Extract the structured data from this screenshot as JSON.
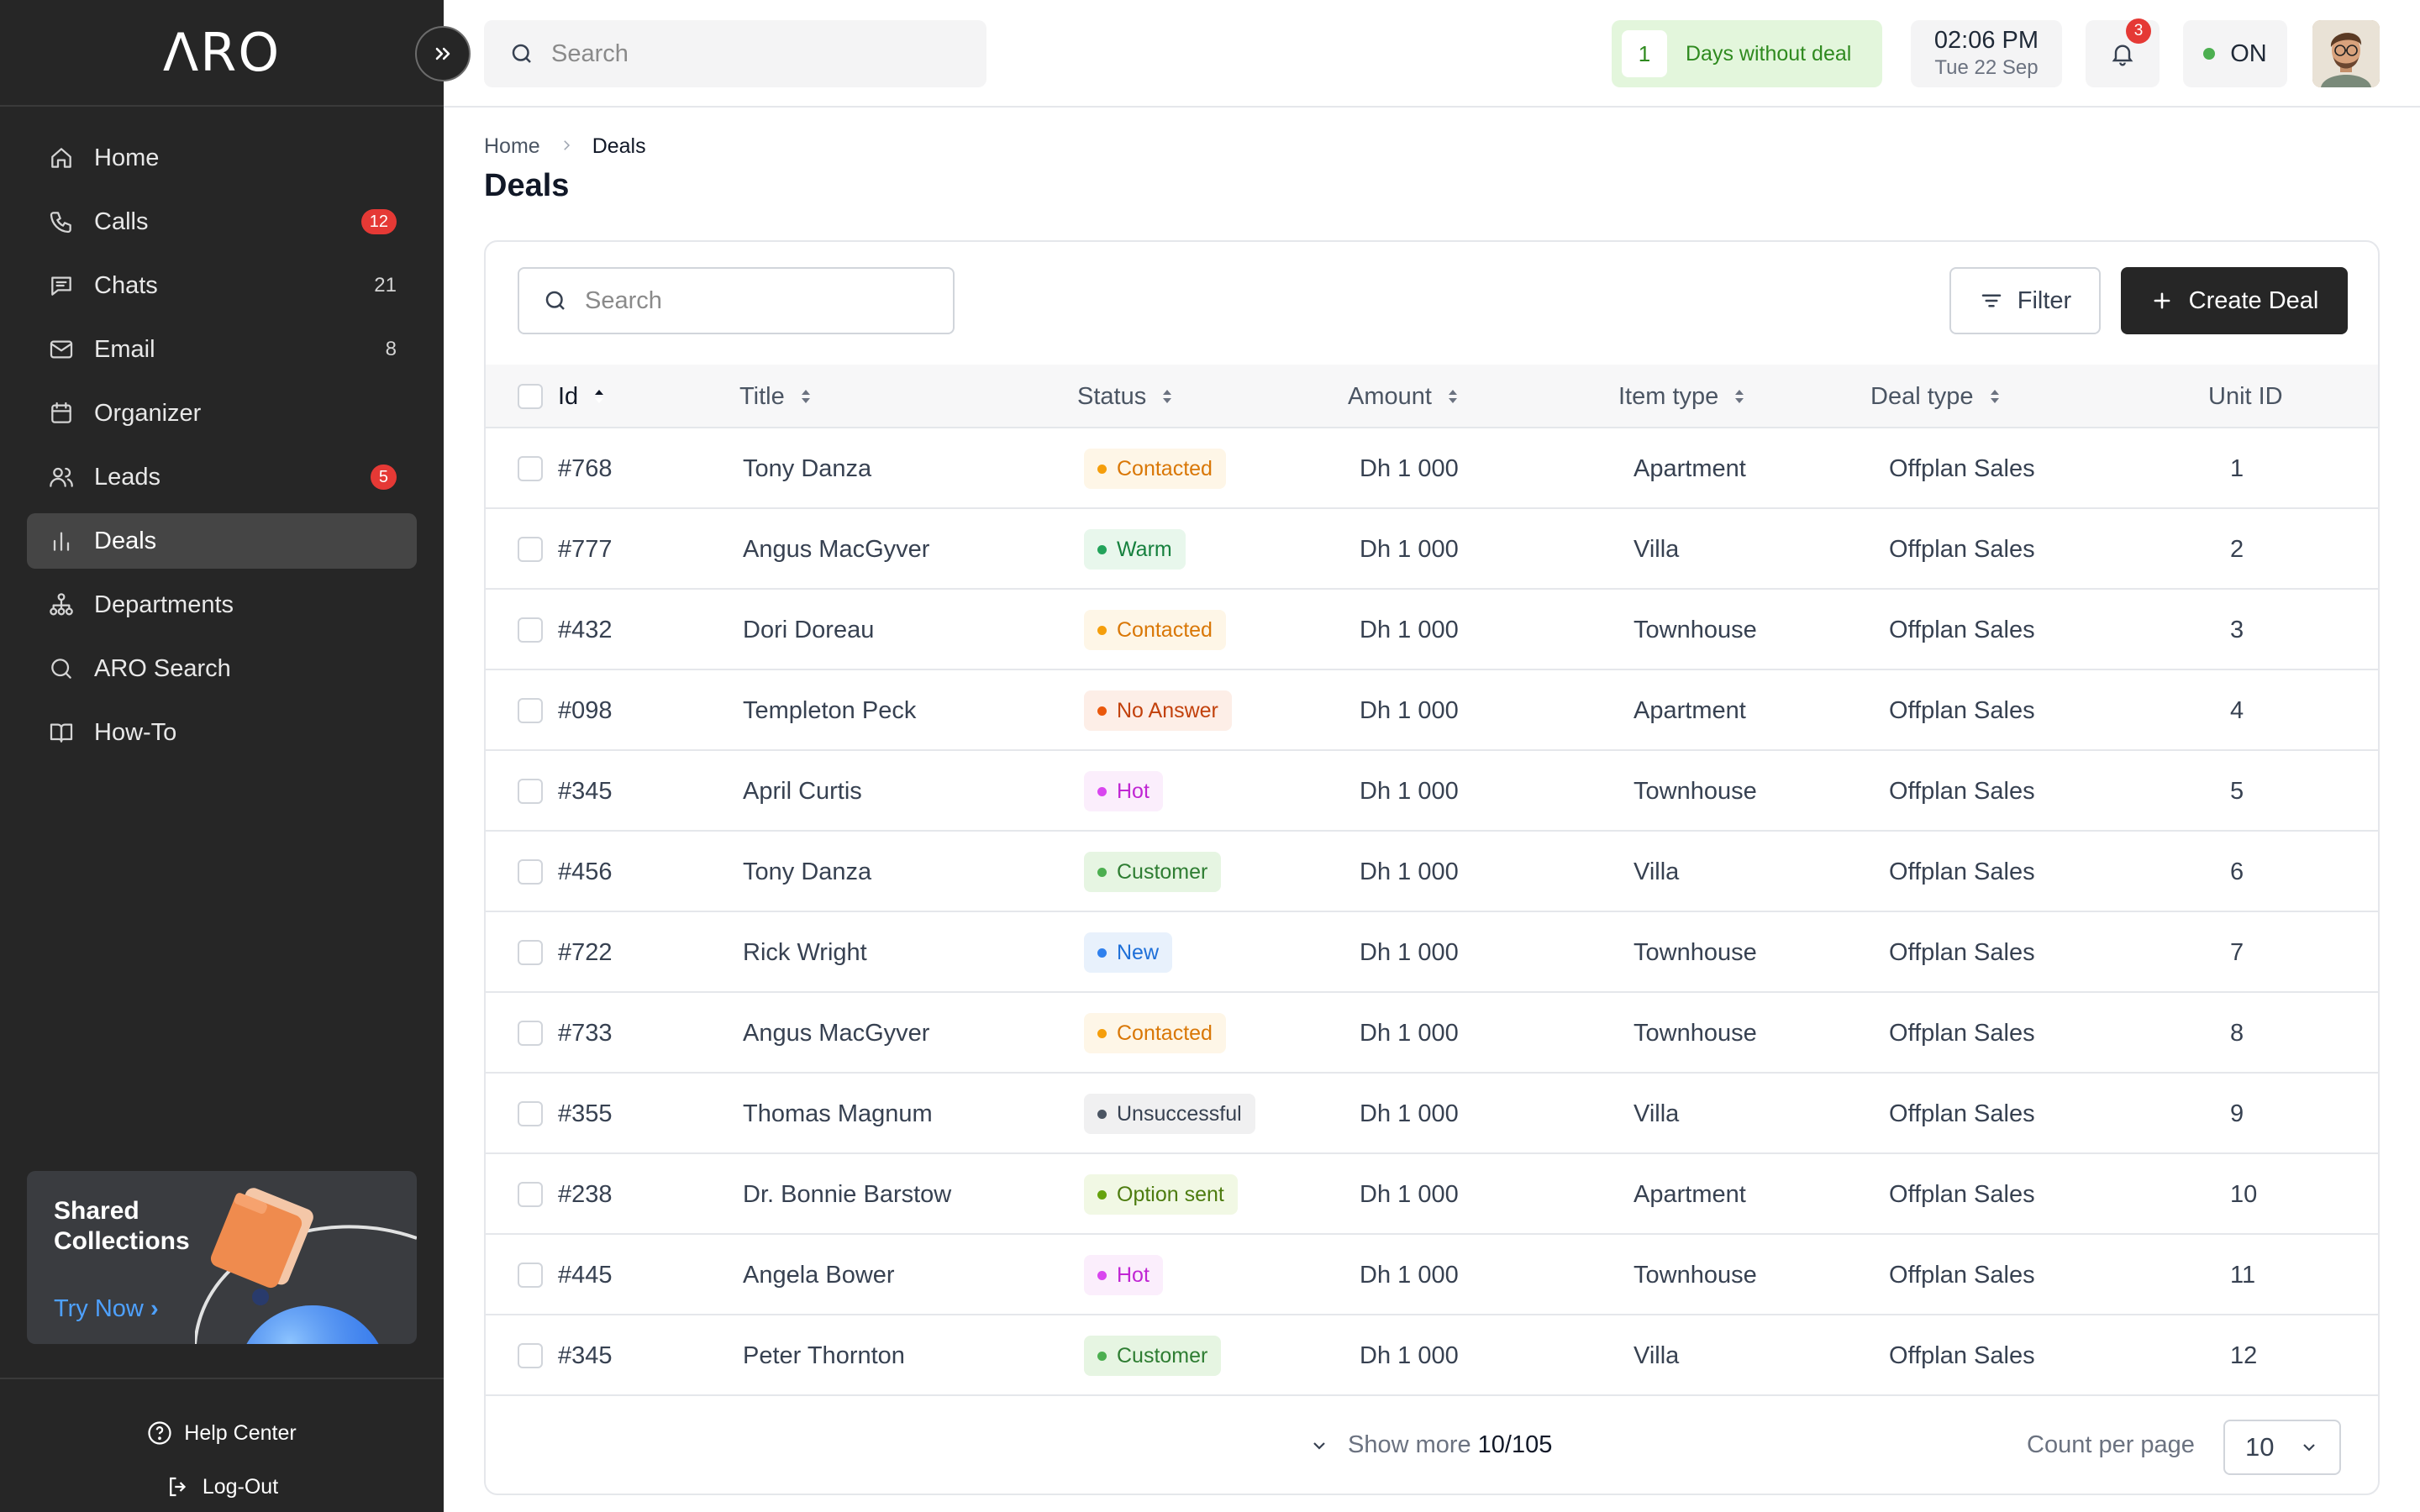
{
  "brand": {
    "logo": "ΛRO"
  },
  "sidebar": {
    "items": [
      {
        "label": "Home",
        "icon": "home-icon",
        "badge": ""
      },
      {
        "label": "Calls",
        "icon": "phone-icon",
        "badge": "12",
        "badge_style": "red"
      },
      {
        "label": "Chats",
        "icon": "chat-icon",
        "badge": "21"
      },
      {
        "label": "Email",
        "icon": "mail-icon",
        "badge": "8"
      },
      {
        "label": "Organizer",
        "icon": "calendar-icon",
        "badge": ""
      },
      {
        "label": "Leads",
        "icon": "users-icon",
        "badge": "5",
        "badge_style": "red"
      },
      {
        "label": "Deals",
        "icon": "bar-chart-icon",
        "badge": "",
        "active": true
      },
      {
        "label": "Departments",
        "icon": "org-chart-icon",
        "badge": ""
      },
      {
        "label": "ARO Search",
        "icon": "search-icon",
        "badge": ""
      },
      {
        "label": "How-To",
        "icon": "book-icon",
        "badge": ""
      }
    ],
    "promo": {
      "title": "Shared Collections",
      "cta": "Try Now"
    },
    "footer": {
      "help": "Help Center",
      "logout": "Log-Out"
    }
  },
  "topbar": {
    "search_placeholder": "Search",
    "deal_counter": {
      "count": "1",
      "label": "Days without deal"
    },
    "clock": {
      "time": "02:06 PM",
      "date": "Tue 22 Sep"
    },
    "notifications": "3",
    "status": "ON"
  },
  "breadcrumb": {
    "root": "Home",
    "current": "Deals"
  },
  "page": {
    "title": "Deals"
  },
  "toolbar": {
    "search_placeholder": "Search",
    "filter_label": "Filter",
    "create_label": "Create Deal"
  },
  "table": {
    "columns": [
      "Id",
      "Title",
      "Status",
      "Amount",
      "Item type",
      "Deal type",
      "Unit ID"
    ],
    "rows": [
      {
        "id": "#768",
        "title": "Tony Danza",
        "status": "Contacted",
        "amount": "Dh 1 000",
        "item": "Apartment",
        "deal": "Offplan Sales",
        "unit": "1"
      },
      {
        "id": "#777",
        "title": "Angus MacGyver",
        "status": "Warm",
        "amount": "Dh 1 000",
        "item": "Villa",
        "deal": "Offplan Sales",
        "unit": "2"
      },
      {
        "id": "#432",
        "title": "Dori Doreau",
        "status": "Contacted",
        "amount": "Dh 1 000",
        "item": "Townhouse",
        "deal": "Offplan Sales",
        "unit": "3"
      },
      {
        "id": "#098",
        "title": "Templeton Peck",
        "status": "No Answer",
        "amount": "Dh 1 000",
        "item": "Apartment",
        "deal": "Offplan Sales",
        "unit": "4"
      },
      {
        "id": "#345",
        "title": "April Curtis",
        "status": "Hot",
        "amount": "Dh 1 000",
        "item": "Townhouse",
        "deal": "Offplan Sales",
        "unit": "5"
      },
      {
        "id": "#456",
        "title": "Tony Danza",
        "status": "Customer",
        "amount": "Dh 1 000",
        "item": "Villa",
        "deal": "Offplan Sales",
        "unit": "6"
      },
      {
        "id": "#722",
        "title": "Rick Wright",
        "status": "New",
        "amount": "Dh 1 000",
        "item": "Townhouse",
        "deal": "Offplan Sales",
        "unit": "7"
      },
      {
        "id": "#733",
        "title": "Angus MacGyver",
        "status": "Contacted",
        "amount": "Dh 1 000",
        "item": "Townhouse",
        "deal": "Offplan Sales",
        "unit": "8"
      },
      {
        "id": "#355",
        "title": "Thomas Magnum",
        "status": "Unsuccessful",
        "amount": "Dh 1 000",
        "item": "Villa",
        "deal": "Offplan Sales",
        "unit": "9"
      },
      {
        "id": "#238",
        "title": "Dr. Bonnie Barstow",
        "status": "Option sent",
        "amount": "Dh 1 000",
        "item": "Apartment",
        "deal": "Offplan Sales",
        "unit": "10"
      },
      {
        "id": "#445",
        "title": "Angela Bower",
        "status": "Hot",
        "amount": "Dh 1 000",
        "item": "Townhouse",
        "deal": "Offplan Sales",
        "unit": "11"
      },
      {
        "id": "#345",
        "title": "Peter Thornton",
        "status": "Customer",
        "amount": "Dh 1 000",
        "item": "Villa",
        "deal": "Offplan Sales",
        "unit": "12"
      }
    ]
  },
  "status_colors": {
    "Contacted": {
      "fg": "#d97706",
      "bg": "#fef6e7",
      "dot": "#f59e0b"
    },
    "Warm": {
      "fg": "#15803d",
      "bg": "#e8f7ec",
      "dot": "#22a35a"
    },
    "No Answer": {
      "fg": "#c2410c",
      "bg": "#fdeee7",
      "dot": "#ea580c"
    },
    "Hot": {
      "fg": "#c026d3",
      "bg": "#fbeefc",
      "dot": "#d946ef"
    },
    "Customer": {
      "fg": "#2e7d32",
      "bg": "#e6f5e2",
      "dot": "#4caf50"
    },
    "New": {
      "fg": "#1d6fd8",
      "bg": "#e8f1fc",
      "dot": "#2f80ed"
    },
    "Unsuccessful": {
      "fg": "#374151",
      "bg": "#f0f0f1",
      "dot": "#4b5563"
    },
    "Option sent": {
      "fg": "#4d7c0f",
      "bg": "#f1f8e4",
      "dot": "#65a30d"
    }
  },
  "footer": {
    "show_more": "Show more",
    "progress": "10/105",
    "count_label": "Count per page",
    "count_value": "10"
  }
}
